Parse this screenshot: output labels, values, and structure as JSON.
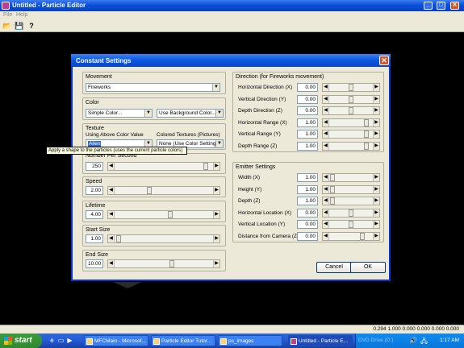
{
  "window": {
    "title": "Untitled - Particle Editor",
    "min": "_",
    "max": "□",
    "close": "✕"
  },
  "menu": {
    "file": "File",
    "help": "Help"
  },
  "toolbar": {
    "open": "📂",
    "save": "💾",
    "help": "?"
  },
  "dialog": {
    "title": "Constant Settings",
    "close": "✕",
    "movement": {
      "label": "Movement",
      "value": "Fireworks"
    },
    "color": {
      "label": "Color",
      "value": "Simple Color...",
      "bg": "Use Background Color..."
    },
    "texture": {
      "label": "Texture",
      "using": "Using Above Color Value",
      "colored": "Colored Textures (Pictures)",
      "value": "Alien",
      "colored_value": "None (Use Color Settings)"
    },
    "nps": {
      "label": "Number Per Second",
      "value": "250"
    },
    "speed": {
      "label": "Speed",
      "value": "2.00"
    },
    "lifetime": {
      "label": "Lifetime",
      "value": "4.00"
    },
    "start_size": {
      "label": "Start Size",
      "value": "1.00"
    },
    "end_size": {
      "label": "End Size",
      "value": "10.00"
    },
    "direction": {
      "label": "Direction (for Fireworks movement)",
      "rows": [
        {
          "label": "Horizontal Direction (X)",
          "value": "0.00",
          "level": 0.5
        },
        {
          "label": "Vertical Direction (Y)",
          "value": "0.00",
          "level": 0.5
        },
        {
          "label": "Depth Direction (Z)",
          "value": "0.00",
          "level": 0.5
        },
        {
          "label": "Horizontal Range (X)",
          "value": "1.00",
          "level": 0.9
        },
        {
          "label": "Vertical Range (Y)",
          "value": "1.00",
          "level": 0.9
        },
        {
          "label": "Depth Range (Z)",
          "value": "1.00",
          "level": 0.9
        }
      ]
    },
    "emitter": {
      "label": "Emitter Settings",
      "rows": [
        {
          "label": "Width (X)",
          "value": "1.00",
          "level": 0.02
        },
        {
          "label": "Height (Y)",
          "value": "1.00",
          "level": 0.02
        },
        {
          "label": "Depth (Z)",
          "value": "1.00",
          "level": 0.02
        },
        {
          "label": "Horizontal Location (X)",
          "value": "0.00",
          "level": 0.5
        },
        {
          "label": "Vertical Location (Y)",
          "value": "0.00",
          "level": 0.5
        },
        {
          "label": "Distance from Camera (Z)",
          "value": "0.00",
          "level": 0.8
        }
      ]
    },
    "cancel": "Cancel",
    "ok": "OK",
    "tooltip": "Apply a shape to the particles (uses the current particle colors)"
  },
  "statusbar": {
    "text": "0.294  1.000  0.000  0.000  0.000  0.000"
  },
  "taskbar": {
    "start": "start",
    "tasks": [
      "MFCMain - Microsof...",
      "Particle Editor Tutor...",
      "ps_images",
      "Untitled - Particle E..."
    ],
    "tray_text": "DVD Drive (D:)",
    "clock": "1:17 AM"
  }
}
